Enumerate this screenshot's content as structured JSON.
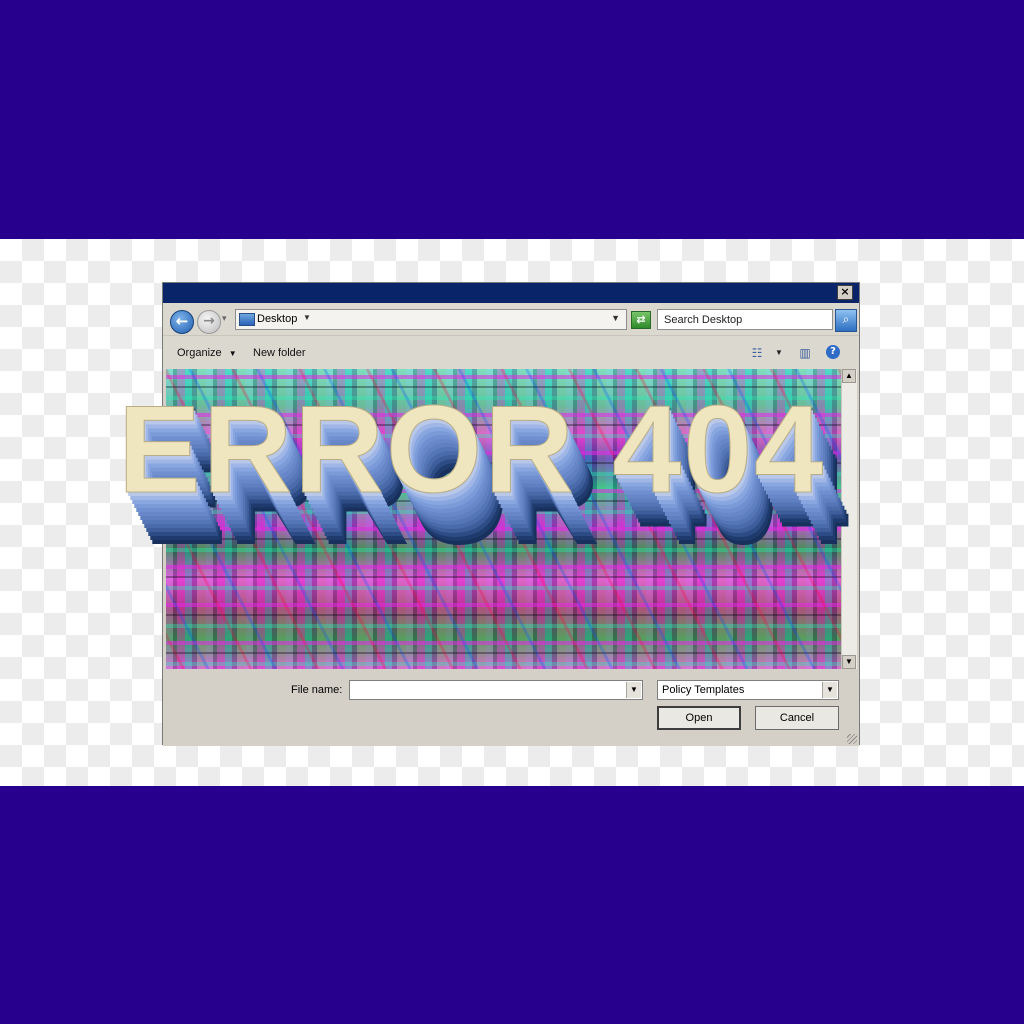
{
  "dialog": {
    "address": {
      "location": "Desktop"
    },
    "search": {
      "placeholder": "Search Desktop"
    },
    "toolbar": {
      "organize_label": "Organize",
      "new_folder_label": "New folder"
    },
    "footer": {
      "file_name_label": "File name:",
      "file_name_value": "",
      "file_type_value": "Policy Templates",
      "open_label": "Open",
      "cancel_label": "Cancel"
    }
  },
  "headline": {
    "text": "ERROR 404"
  },
  "colors": {
    "band": "#27008d",
    "titlebar": "#0a246a",
    "headline_face": "#efe6c0",
    "headline_extrude": "#6f8fd0"
  },
  "icons": [
    "back-arrow-icon",
    "forward-arrow-icon",
    "monitor-icon",
    "refresh-icon",
    "search-icon",
    "view-icon",
    "preview-pane-icon",
    "help-icon",
    "close-icon"
  ]
}
